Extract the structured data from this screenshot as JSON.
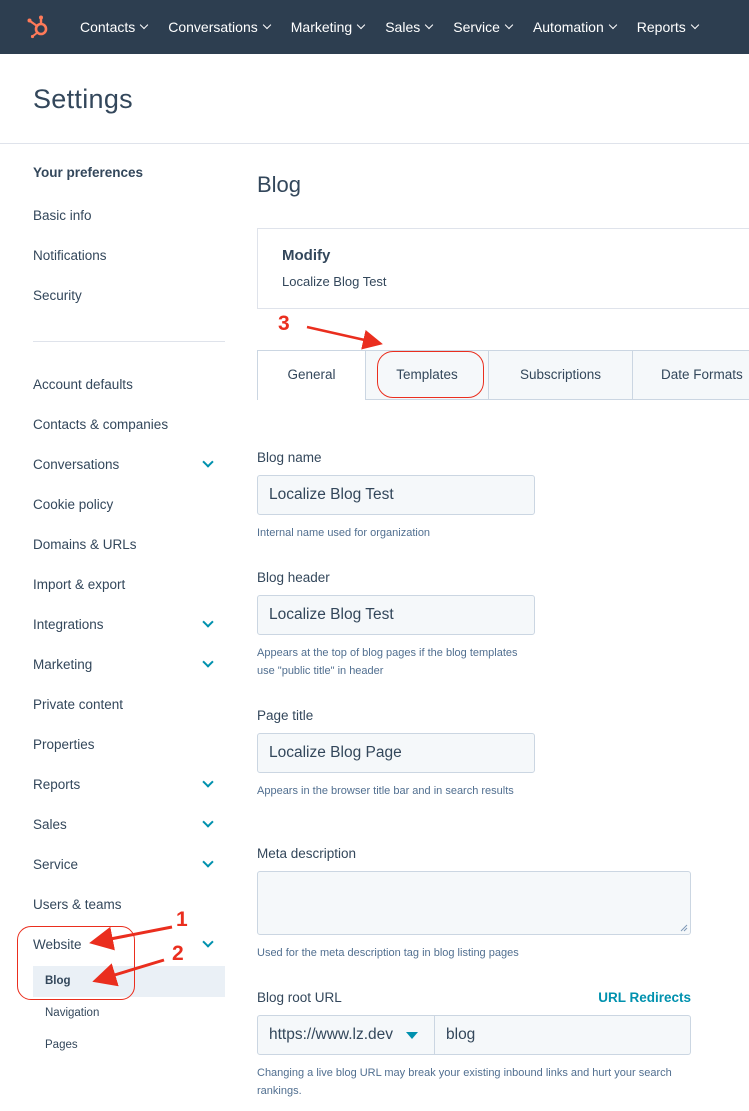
{
  "topnav": {
    "items": [
      {
        "label": "Contacts"
      },
      {
        "label": "Conversations"
      },
      {
        "label": "Marketing"
      },
      {
        "label": "Sales"
      },
      {
        "label": "Service"
      },
      {
        "label": "Automation"
      },
      {
        "label": "Reports"
      }
    ]
  },
  "header": {
    "title": "Settings"
  },
  "sidebar": {
    "heading": "Your preferences",
    "preferences": [
      {
        "label": "Basic info"
      },
      {
        "label": "Notifications"
      },
      {
        "label": "Security"
      }
    ],
    "account": [
      {
        "label": "Account defaults"
      },
      {
        "label": "Contacts & companies"
      },
      {
        "label": "Conversations"
      },
      {
        "label": "Cookie policy"
      },
      {
        "label": "Domains & URLs"
      },
      {
        "label": "Import & export"
      },
      {
        "label": "Integrations"
      },
      {
        "label": "Marketing"
      },
      {
        "label": "Private content"
      },
      {
        "label": "Properties"
      },
      {
        "label": "Reports"
      },
      {
        "label": "Sales"
      },
      {
        "label": "Service"
      },
      {
        "label": "Users & teams"
      },
      {
        "label": "Website"
      }
    ],
    "website_sub": [
      {
        "label": "Blog"
      },
      {
        "label": "Navigation"
      },
      {
        "label": "Pages"
      }
    ]
  },
  "main": {
    "title": "Blog",
    "modify": {
      "title": "Modify",
      "subtitle": "Localize Blog Test"
    },
    "tabs": [
      {
        "label": "General"
      },
      {
        "label": "Templates"
      },
      {
        "label": "Subscriptions"
      },
      {
        "label": "Date Formats"
      }
    ],
    "fields": {
      "blog_name": {
        "label": "Blog name",
        "value": "Localize Blog Test",
        "help": "Internal name used for organization"
      },
      "blog_header": {
        "label": "Blog header",
        "value": "Localize Blog Test",
        "help": "Appears at the top of blog pages if the blog templates use \"public title\" in header"
      },
      "page_title": {
        "label": "Page title",
        "value": "Localize Blog Page",
        "help": "Appears in the browser title bar and in search results"
      },
      "meta_description": {
        "label": "Meta description",
        "value": "",
        "help": "Used for the meta description tag in blog listing pages"
      },
      "blog_root_url": {
        "label": "Blog root URL",
        "link": "URL Redirects",
        "domain": "https://www.lz.dev",
        "slug": "blog",
        "help": "Changing a live blog URL may break your existing inbound links and hurt your search rankings."
      }
    }
  },
  "annotations": {
    "one": "1",
    "two": "2",
    "three": "3"
  },
  "colors": {
    "nav_bg": "#2d3e50",
    "accent": "#0091ae",
    "annotation": "#ea2e1e",
    "logo": "#ff7a59"
  }
}
